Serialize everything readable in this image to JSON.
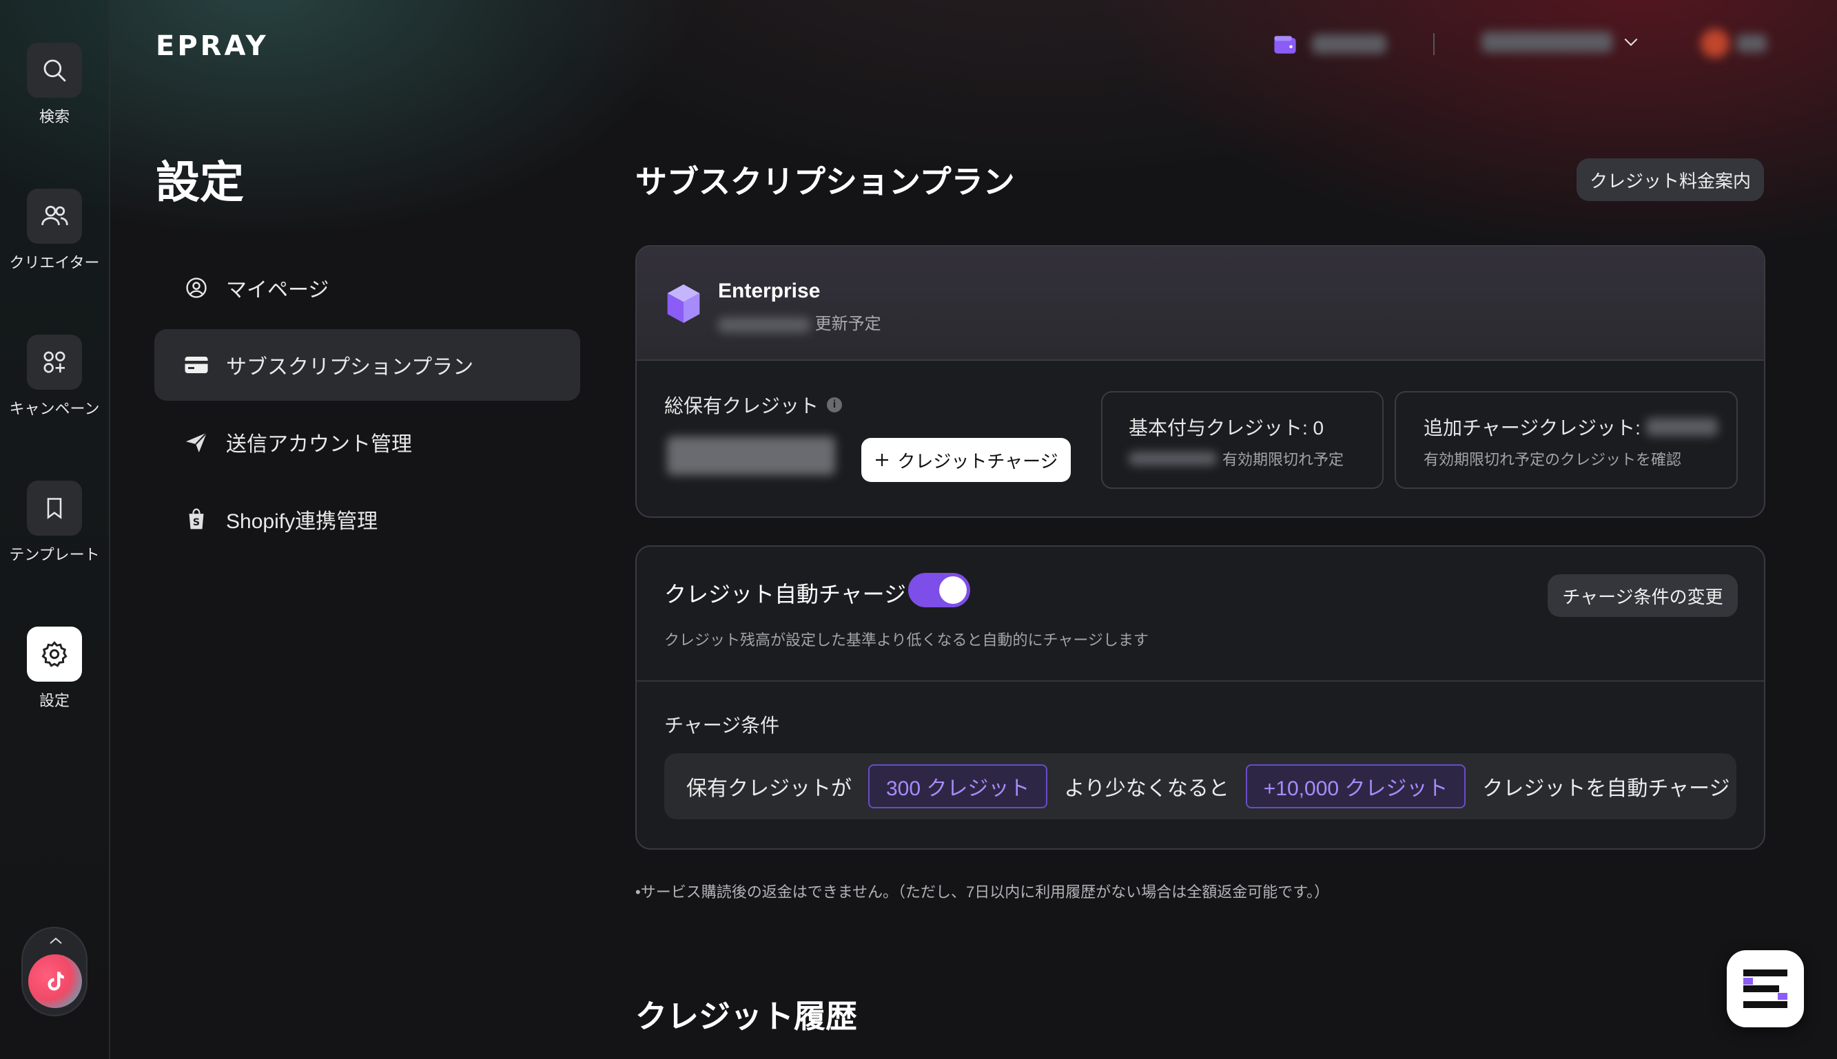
{
  "brand": {
    "logo_text": "EPRAY"
  },
  "rail": {
    "items": [
      {
        "label": "検索",
        "icon": "search-icon"
      },
      {
        "label": "クリエイター",
        "icon": "users-icon"
      },
      {
        "label": "キャンペーン",
        "icon": "apps-icon"
      },
      {
        "label": "テンプレート",
        "icon": "bookmark-icon"
      },
      {
        "label": "設定",
        "icon": "gear-icon",
        "active": true
      }
    ],
    "bottom_icon": "tiktok-icon"
  },
  "settings": {
    "title": "設定",
    "nav": [
      {
        "label": "マイページ",
        "icon": "user-circle-icon"
      },
      {
        "label": "サブスクリプションプラン",
        "icon": "credit-card-icon",
        "active": true
      },
      {
        "label": "送信アカウント管理",
        "icon": "send-icon"
      },
      {
        "label": "Shopify連携管理",
        "icon": "shopify-bag-icon"
      }
    ]
  },
  "main": {
    "title": "サブスクリプションプラン",
    "pricing_button": "クレジット料金案内",
    "plan": {
      "name": "Enterprise",
      "renew_suffix": "更新予定",
      "total_label": "総保有クレジット",
      "charge_button": "クレジットチャージ",
      "base_label": "基本付与クレジット: 0",
      "base_sub": "有効期限切れ予定",
      "extra_label": "追加チャージクレジット:",
      "extra_sub": "有効期限切れ予定のクレジットを確認"
    },
    "auto": {
      "title": "クレジット自動チャージ",
      "enabled": true,
      "desc": "クレジット残高が設定した基準より低くなると自動的にチャージします",
      "change_button": "チャージ条件の変更",
      "cond_title": "チャージ条件",
      "cond_prefix": "保有クレジットが",
      "threshold": "300 クレジット",
      "cond_mid": "より少なくなると",
      "amount": "+10,000 クレジット",
      "cond_suffix": "クレジットを自動チャージ"
    },
    "note": "•サービス購読後の返金はできません。（ただし、7日以内に利用履歴がない場合は全額返金可能です。）",
    "history_title": "クレジット履歴"
  },
  "colors": {
    "accent": "#7d4ee8",
    "chip_text": "#a98bff"
  }
}
